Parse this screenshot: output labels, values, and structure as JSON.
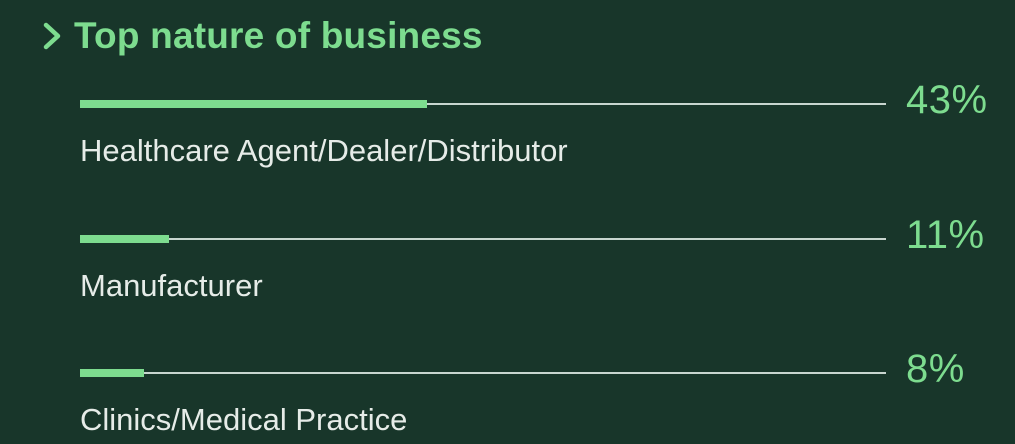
{
  "chart_data": {
    "type": "bar",
    "title": "Top nature of business",
    "categories": [
      "Healthcare Agent/Dealer/Distributor",
      "Manufacturer",
      "Clinics/Medical Practice"
    ],
    "values": [
      43,
      11,
      8
    ],
    "value_labels": [
      "43%",
      "11%",
      "8%"
    ],
    "xlim": [
      0,
      100
    ],
    "orientation": "horizontal",
    "grid": false
  },
  "colors": {
    "background": "#18362a",
    "accent": "#7ddc8f",
    "track": "#c8d6cf",
    "label": "#e6ece8"
  },
  "icons": {
    "title_prefix": "chevron-right-icon"
  }
}
